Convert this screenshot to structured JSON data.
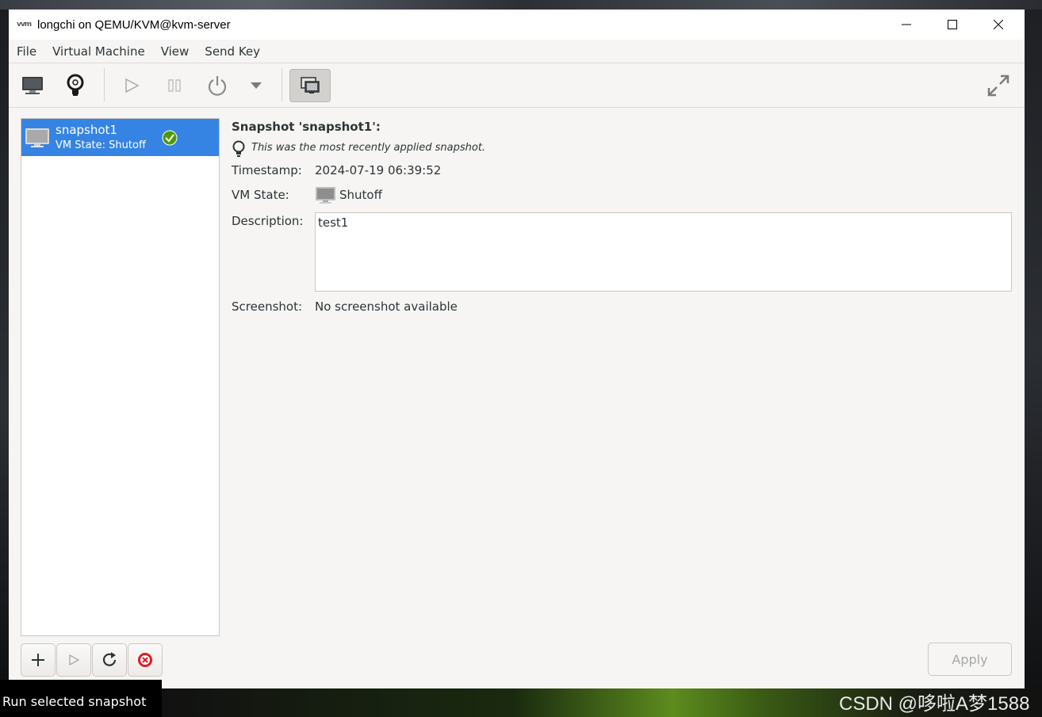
{
  "window": {
    "title": "longchi on QEMU/KVM@kvm-server",
    "app_icon": "vvm"
  },
  "menu": [
    "File",
    "Virtual Machine",
    "View",
    "Send Key"
  ],
  "snapshot_list": [
    {
      "name": "snapshot1",
      "state": "VM State: Shutoff",
      "current": true
    }
  ],
  "details": {
    "title": "Snapshot 'snapshot1':",
    "hint": "This was the most recently applied snapshot.",
    "timestamp_label": "Timestamp:",
    "timestamp_value": "2024-07-19 06:39:52",
    "vm_state_label": "VM State:",
    "vm_state_value": "Shutoff",
    "description_label": "Description:",
    "description_value": "test1",
    "screenshot_label": "Screenshot:",
    "screenshot_value": "No screenshot available"
  },
  "buttons": {
    "apply": "Apply"
  },
  "tooltip": "Run selected snapshot",
  "watermark": "CSDN @哆啦A梦1588",
  "colors": {
    "selection": "#3584e4",
    "window_bg": "#f6f5f4",
    "check_green": "#4e9a06"
  }
}
